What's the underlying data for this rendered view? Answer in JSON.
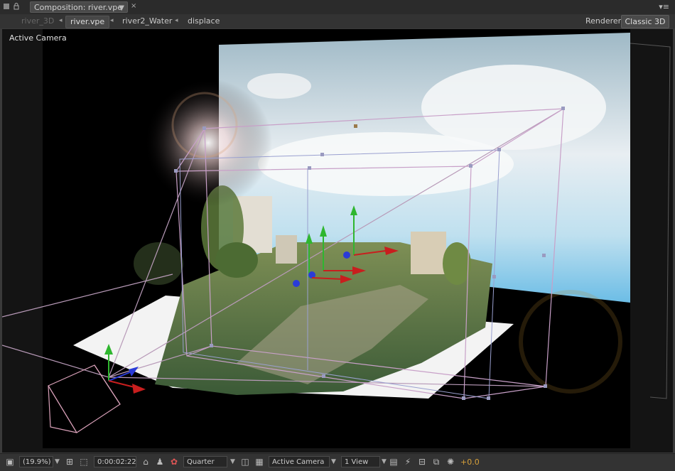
{
  "tab": {
    "title": "Composition: river.vpe",
    "menu": "▼",
    "close": "×"
  },
  "breadcrumbs": [
    {
      "label": "river_3D"
    },
    {
      "label": "river.vpe"
    },
    {
      "label": "river2_Water"
    },
    {
      "label": "displace"
    }
  ],
  "renderer": {
    "label": "Renderer:",
    "value": "Classic 3D"
  },
  "viewer": {
    "label": "Active Camera"
  },
  "bottom": {
    "zoom": "(19.9%)",
    "timecode": "0:00:02:22",
    "resolution": "Quarter",
    "view": "Active Camera",
    "layout": "1 View",
    "exposure": "+0.0"
  },
  "colors": {
    "accent": "#d8a13a",
    "axis_x": "#c81e1e",
    "axis_y": "#2fb62f",
    "axis_z": "#2a3bd8",
    "bounding_box": "#c8a0c8"
  }
}
